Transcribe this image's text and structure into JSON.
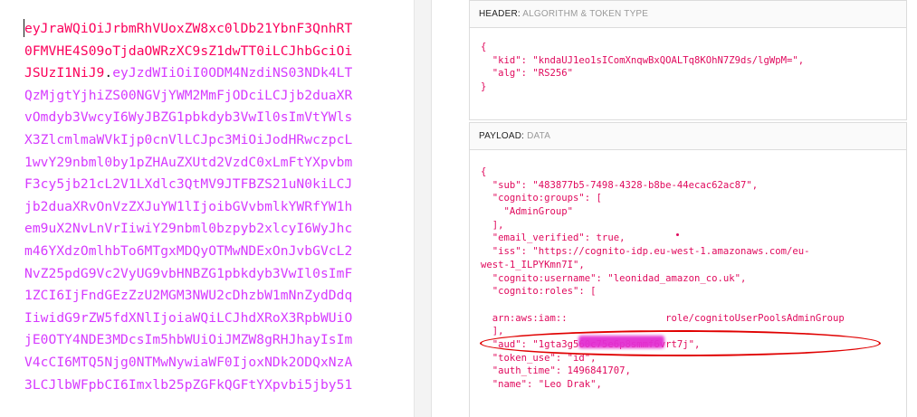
{
  "encoded": {
    "lines": [
      {
        "header": "eyJraWQiOiJrbmRhVUoxZW8xc0lDb21YbnF3QnhRT",
        "payload": ""
      },
      {
        "header": "0FMVHE4S09oTjdaOWRzXC9sZ1dwTT0iLCJhbGciOi",
        "payload": ""
      },
      {
        "header": "JSUzI1NiJ9",
        "dot": ".",
        "payload": "eyJzdWIiOiI0ODM4NzdiNS03NDk4LT"
      },
      {
        "header": "",
        "payload": "QzMjgtYjhiZS00NGVjYWM2MmFjODciLCJjb2duaXR"
      },
      {
        "header": "",
        "payload": "vOmdyb3VwcyI6WyJBZG1pbkdyb3VwIl0sImVtYWls"
      },
      {
        "header": "",
        "payload": "X3ZlcmlmaWVkIjp0cnVlLCJpc3MiOiJodHRwczpcL"
      },
      {
        "header": "",
        "payload": "1wvY29nbml0by1pZHAuZXUtd2VzdC0xLmFtYXpvbm"
      },
      {
        "header": "",
        "payload": "F3cy5jb21cL2V1LXdlc3QtMV9JTFBZS21uN0kiLCJ"
      },
      {
        "header": "",
        "payload": "jb2duaXRvOnVzZXJuYW1lIjoibGVvbmlkYWRfYW1h"
      },
      {
        "header": "",
        "payload": "em9uX2NvLnVrIiwiY29nbml0bzpyb2xlcyI6WyJhc"
      },
      {
        "header": "",
        "payload": "m46YXdzOmlhbTo6MTgxMDQyOTMwNDExOnJvbGVcL2"
      },
      {
        "header": "",
        "payload": "NvZ25pdG9Vc2VyUG9vbHNBZG1pbkdyb3VwIl0sImF"
      },
      {
        "header": "",
        "payload": "1ZCI6IjFndGEzZzU2MGM3NWU2cDhzbW1mNnZydDdq"
      },
      {
        "header": "",
        "payload": "IiwidG9rZW5fdXNlIjoiaWQiLCJhdXRoX3RpbWUiO"
      },
      {
        "header": "",
        "payload": "jE0OTY4NDE3MDcsIm5hbWUiOiJMZW8gRHJhayIsIm"
      },
      {
        "header": "",
        "payload": "V4cCI6MTQ5Njg0NTMwNywiaWF0IjoxNDk2ODQxNzA"
      },
      {
        "header": "",
        "payload": "3LCJlbWFpbCI6Imxlb25pZGFkQGFtYXpvbi5jby51"
      }
    ]
  },
  "header_panel": {
    "title": "HEADER:",
    "subtitle": "ALGORITHM & TOKEN TYPE",
    "json_lines": [
      "{",
      "  \"kid\": \"kndaUJ1eo1sIComXnqwBxQOALTq8KOhN7Z9ds/lgWpM=\",",
      "  \"alg\": \"RS256\"",
      "}"
    ]
  },
  "payload_panel": {
    "title": "PAYLOAD:",
    "subtitle": "DATA",
    "json_lines": [
      "{",
      "  \"sub\": \"483877b5-7498-4328-b8be-44ecac62ac87\",",
      "  \"cognito:groups\": [",
      "    \"AdminGroup\"",
      "  ],",
      "  \"email_verified\": true,",
      "  \"iss\": \"https://cognito-idp.eu-west-1.amazonaws.com/eu-",
      "west-1_ILPYKmn7I\",",
      "  \"cognito:username\": \"leonidad_amazon_co.uk\",",
      "  \"cognito:roles\": [",
      "",
      "  arn:aws:iam::                 role/cognitoUserPoolsAdminGroup",
      "  ],",
      "  \"aud\": \"1gta3g560c75e6p8smmf6vrt7j\",",
      "  \"token_use\": \"id\",",
      "  \"auth_time\": 1496841707,",
      "  \"name\": \"Leo Drak\","
    ]
  },
  "colors": {
    "header_token": "#fb015b",
    "payload_token": "#d63aff",
    "json_text": "#e00a5d",
    "highlight": "#e00000"
  }
}
